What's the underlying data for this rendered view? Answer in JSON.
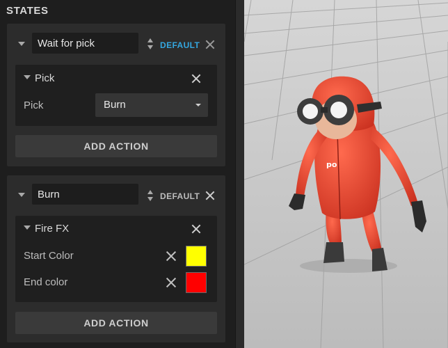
{
  "panel": {
    "title": "STATES",
    "states": [
      {
        "name": "Wait for pick",
        "default_label": "DEFAULT",
        "is_default": true,
        "actions": [
          {
            "title": "Pick",
            "property_label": "Pick",
            "property_value": "Burn"
          }
        ],
        "add_action_label": "ADD ACTION"
      },
      {
        "name": "Burn",
        "default_label": "DEFAULT",
        "is_default": false,
        "actions": [
          {
            "title": "Fire FX",
            "start_color_label": "Start Color",
            "start_color": "#ffff00",
            "end_color_label": "End color",
            "end_color": "#ff0000"
          }
        ],
        "add_action_label": "ADD ACTION"
      }
    ]
  },
  "colors": {
    "accent": "#34a7e0",
    "inactive_default": "#bdbdbd",
    "panel_bg": "#2c2c2c",
    "viewport_bg": "#c9c9c9",
    "character_suit": "#e8402e"
  },
  "viewport": {
    "content": "3d-scene-character"
  }
}
